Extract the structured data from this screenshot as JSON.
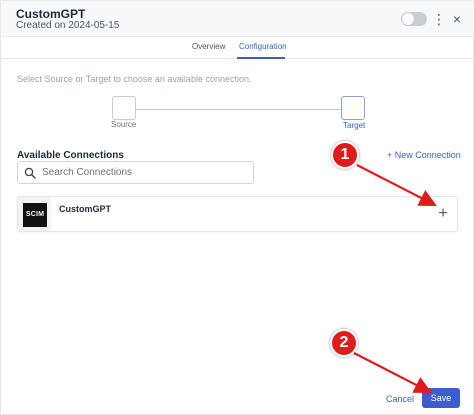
{
  "header": {
    "title": "CustomGPT",
    "subtitle": "Created on 2024-05-15",
    "toggle_on": false
  },
  "tabs": [
    {
      "label": "Overview",
      "active": false
    },
    {
      "label": "Configuration",
      "active": true
    }
  ],
  "instruction": "Select Source or Target to choose an available connection.",
  "stepper": {
    "source_label": "Source",
    "target_label": "Target",
    "selected": "Target"
  },
  "connections": {
    "title": "Available Connections",
    "new_connection_label": "+ New Connection",
    "search_placeholder": "Search Connections",
    "items": [
      {
        "name": "CustomGPT",
        "logo_text": "SCIM"
      }
    ]
  },
  "footer": {
    "cancel_label": "Cancel",
    "save_label": "Save"
  },
  "annotations": {
    "badge_1": "1",
    "badge_2": "2",
    "color": "#e01b1b"
  },
  "colors": {
    "accent": "#3a5fcd",
    "annotation": "#e01b1b"
  }
}
